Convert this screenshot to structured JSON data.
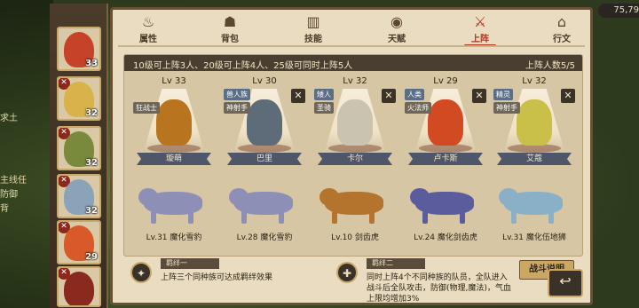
{
  "currency": "75,79",
  "tabs": [
    {
      "label": "属性",
      "icon": "flame-icon"
    },
    {
      "label": "背包",
      "icon": "bag-icon"
    },
    {
      "label": "技能",
      "icon": "book-icon"
    },
    {
      "label": "天赋",
      "icon": "eye-icon"
    },
    {
      "label": "上阵",
      "icon": "crossed-swords-icon",
      "active": true
    },
    {
      "label": "行文",
      "icon": "house-icon"
    }
  ],
  "side_heroes": [
    {
      "level": "33",
      "color": "#c6432a"
    },
    {
      "level": "32",
      "color": "#d9b34a"
    },
    {
      "level": "32",
      "color": "#7a8a3c"
    },
    {
      "level": "32",
      "color": "#8aa3b8"
    },
    {
      "level": "29",
      "color": "#d85a2a"
    },
    {
      "level": "",
      "color": "#8a2a1e"
    }
  ],
  "bg_snippets": [
    "求土",
    "主线任",
    "防御",
    "背"
  ],
  "lineup": {
    "rule": "10级可上阵3人、20级可上阵4人、25级可同时上阵5人",
    "count": "上阵人数5/5",
    "slots": [
      {
        "level": "Lv 33",
        "race": "",
        "cls": "狂战士",
        "name": "璇萌",
        "char_color": "#b8741e",
        "removable": false,
        "beast_name": "Lv.31 魔化雪豹",
        "beast_color": "#8e8fb6"
      },
      {
        "level": "Lv 30",
        "race": "兽人族",
        "cls": "神射手",
        "name": "巴里",
        "char_color": "#5e6c7a",
        "removable": true,
        "beast_name": "Lv.28 魔化雪豹",
        "beast_color": "#8e8fb6"
      },
      {
        "level": "Lv 32",
        "race": "矮人",
        "cls": "圣骑",
        "name": "卡尔",
        "char_color": "#c9c3b0",
        "removable": true,
        "beast_name": "Lv.10 剑齿虎",
        "beast_color": "#b4742e"
      },
      {
        "level": "Lv 29",
        "race": "人类",
        "cls": "火法师",
        "name": "卢卡斯",
        "char_color": "#d24a22",
        "removable": true,
        "beast_name": "Lv.24 魔化剑齿虎",
        "beast_color": "#5b5c9e"
      },
      {
        "level": "Lv 32",
        "race": "精灵",
        "cls": "神射手",
        "name": "艾蔻",
        "char_color": "#c9c04a",
        "removable": true,
        "beast_name": "Lv.31 魔化伍地狮",
        "beast_color": "#8ab0c8"
      }
    ]
  },
  "bonds": [
    {
      "title": "羁绊一",
      "text": "上阵三个同种族可达成羁绊效果"
    },
    {
      "title": "羁绊二",
      "text_lines": [
        "同时上阵4个不同种族的队员，全队进入",
        "战斗后全队攻击，防御(物理,魔法)，气血",
        "上限均增加3%"
      ]
    }
  ],
  "help_button": "战斗说明"
}
